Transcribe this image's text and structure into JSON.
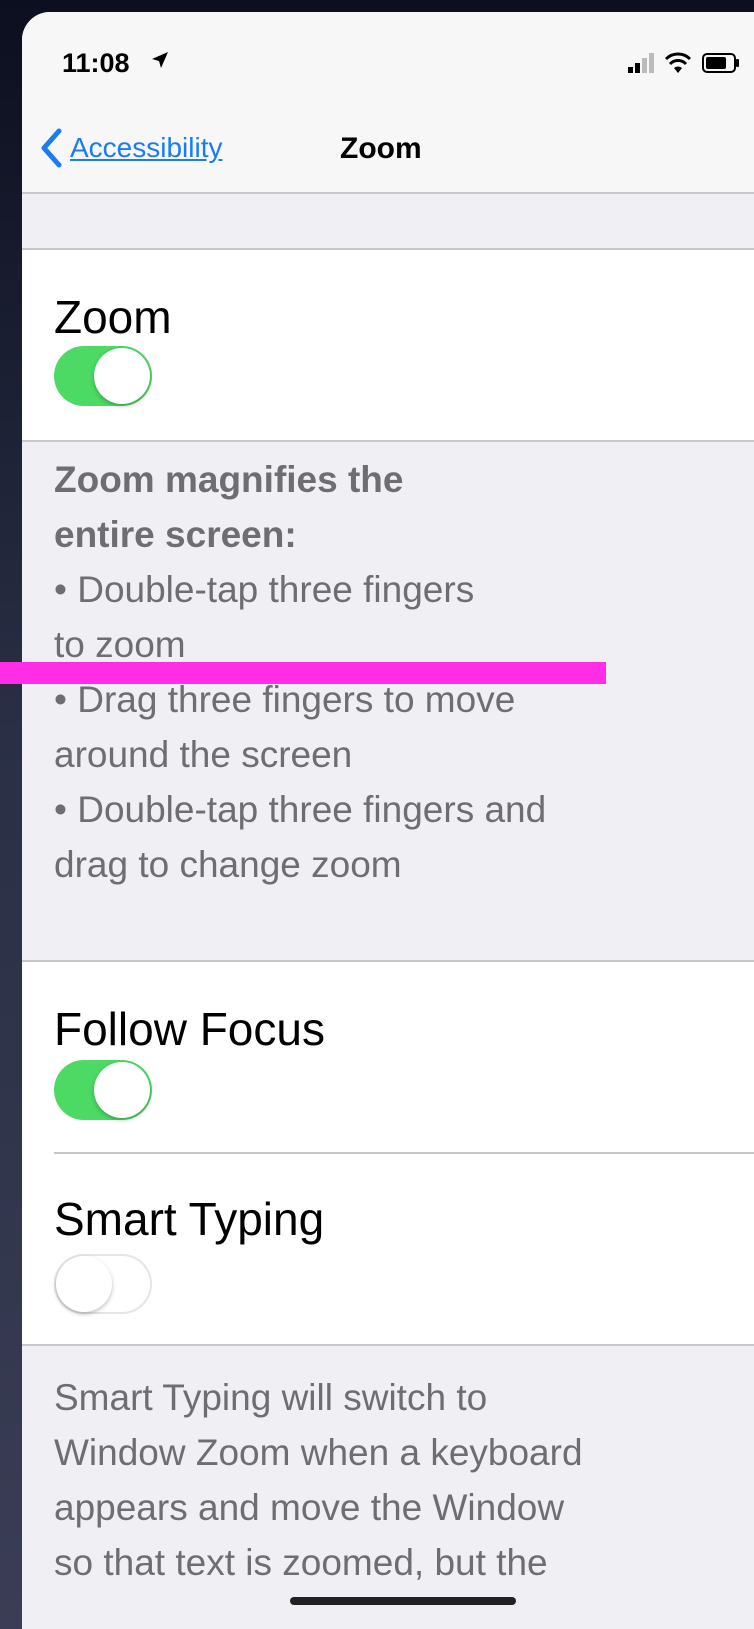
{
  "status_bar": {
    "time": "11:08",
    "location_icon": "location-arrow-icon",
    "signal_icon": "cellular-signal-icon",
    "wifi_icon": "wifi-icon",
    "battery_icon": "battery-icon"
  },
  "nav": {
    "back_label": "Accessibility",
    "back_icon": "chevron-left-icon",
    "title": "Zoom"
  },
  "zoom": {
    "label": "Zoom",
    "enabled": true,
    "description_heading": [
      "Zoom magnifies the",
      "entire screen:"
    ],
    "description_lines": [
      "• Double-tap three fingers",
      "to zoom",
      "• Drag three fingers to move",
      "around the screen",
      "• Double-tap three fingers and",
      "drag to change zoom"
    ]
  },
  "follow_focus": {
    "label": "Follow Focus",
    "enabled": true
  },
  "smart_typing": {
    "label": "Smart Typing",
    "enabled": false,
    "description_lines": [
      "Smart Typing will switch to",
      "Window Zoom when a keyboard",
      "appears and move the Window",
      "so that text is zoomed, but the"
    ]
  },
  "colors": {
    "accent": "#1a7cf0",
    "toggle_on": "#4cd964",
    "annotation_bar": "#ff2ee6"
  }
}
